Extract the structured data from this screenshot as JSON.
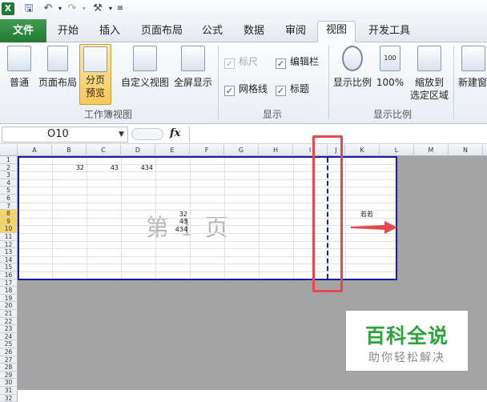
{
  "quick_access": {
    "icons": [
      "excel-icon",
      "save-icon",
      "undo-icon",
      "redo-icon",
      "tools-icon",
      "customize-icon"
    ]
  },
  "tabs": [
    {
      "label": "文件",
      "active": false
    },
    {
      "label": "开始",
      "active": false
    },
    {
      "label": "插入",
      "active": false
    },
    {
      "label": "页面布局",
      "active": false
    },
    {
      "label": "公式",
      "active": false
    },
    {
      "label": "数据",
      "active": false
    },
    {
      "label": "审阅",
      "active": false
    },
    {
      "label": "视图",
      "active": true
    },
    {
      "label": "开发工具",
      "active": false
    }
  ],
  "ribbon": {
    "workbook_views": {
      "group_label": "工作簿视图",
      "buttons": [
        {
          "label": "普通"
        },
        {
          "label": "页面布局"
        },
        {
          "label_line1": "分页",
          "label_line2": "预览",
          "selected": true
        },
        {
          "label": "自定义视图"
        },
        {
          "label": "全屏显示"
        }
      ]
    },
    "show": {
      "group_label": "显示",
      "ruler": {
        "label": "标尺",
        "checked": true,
        "disabled": true
      },
      "formula_bar": {
        "label": "编辑栏",
        "checked": true
      },
      "gridlines": {
        "label": "网格线",
        "checked": true
      },
      "headings": {
        "label": "标题",
        "checked": true
      }
    },
    "zoom": {
      "group_label": "显示比例",
      "buttons": [
        {
          "label": "显示比例"
        },
        {
          "label": "100%"
        },
        {
          "label_line1": "缩放到",
          "label_line2": "选定区域"
        }
      ]
    },
    "window": {
      "new_window_label": "新建窗"
    }
  },
  "formula_bar": {
    "name_box": "O10",
    "fx_symbol": "fx",
    "content": ""
  },
  "sheet": {
    "columns": [
      "A",
      "B",
      "C",
      "D",
      "E",
      "F",
      "G",
      "H",
      "I",
      "J",
      "K",
      "L",
      "M",
      "N"
    ],
    "rows": [
      "1",
      "2",
      "3",
      "4",
      "5",
      "6",
      "7",
      "8",
      "9",
      "10",
      "11",
      "12",
      "13",
      "14",
      "15",
      "16",
      "17",
      "18",
      "19",
      "20",
      "21",
      "22",
      "23",
      "24",
      "25",
      "26",
      "27",
      "28",
      "29",
      "30",
      "31",
      "32"
    ],
    "selected_rows": [
      "8",
      "9",
      "10"
    ],
    "cells": [
      {
        "ref": "B2",
        "value": "32"
      },
      {
        "ref": "C2",
        "value": "43"
      },
      {
        "ref": "D2",
        "value": "434"
      },
      {
        "ref": "E8",
        "value": "32"
      },
      {
        "ref": "E9",
        "value": "43"
      },
      {
        "ref": "E10",
        "value": "434"
      }
    ],
    "page_watermark": "第 1 页",
    "outside_text": "若若"
  },
  "logo": {
    "title": "百科全说",
    "subtitle": "助你轻松解决"
  },
  "colors": {
    "file_tab": "#2f8a40",
    "page_border": "#1020a0",
    "highlight_box": "#e5484d",
    "logo_green": "#2aa53a"
  }
}
